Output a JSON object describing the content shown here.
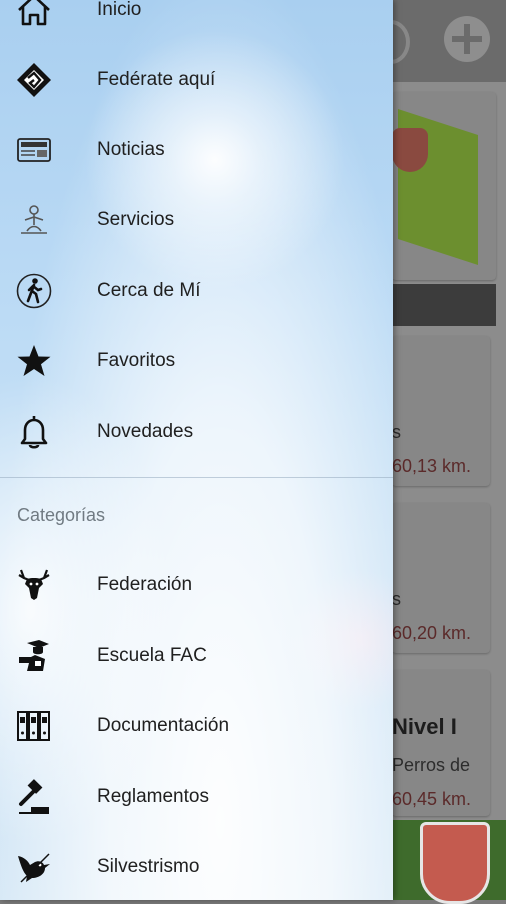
{
  "drawer": {
    "main_items": [
      {
        "label": "Inicio",
        "icon": "home-icon"
      },
      {
        "label": "Fedérate aquí",
        "icon": "federate-icon"
      },
      {
        "label": "Noticias",
        "icon": "news-icon"
      },
      {
        "label": "Servicios",
        "icon": "services-icon"
      },
      {
        "label": "Cerca de Mí",
        "icon": "walking-person-icon"
      },
      {
        "label": "Favoritos",
        "icon": "star-icon"
      },
      {
        "label": "Novedades",
        "icon": "bell-icon"
      }
    ],
    "categories_header": "Categorías",
    "category_items": [
      {
        "label": "Federación",
        "icon": "deer-head-icon"
      },
      {
        "label": "Escuela FAC",
        "icon": "school-icon"
      },
      {
        "label": "Documentación",
        "icon": "folders-icon"
      },
      {
        "label": "Reglamentos",
        "icon": "gavel-icon"
      },
      {
        "label": "Silvestrismo",
        "icon": "bird-icon"
      }
    ]
  },
  "background": {
    "card1_text": "s",
    "card1_distance": "60,13 km.",
    "card2_text": "s",
    "card2_distance": "60,20 km.",
    "card3_title": "Nivel I",
    "card3_text": "Perros de",
    "card3_distance": "60,45 km."
  }
}
